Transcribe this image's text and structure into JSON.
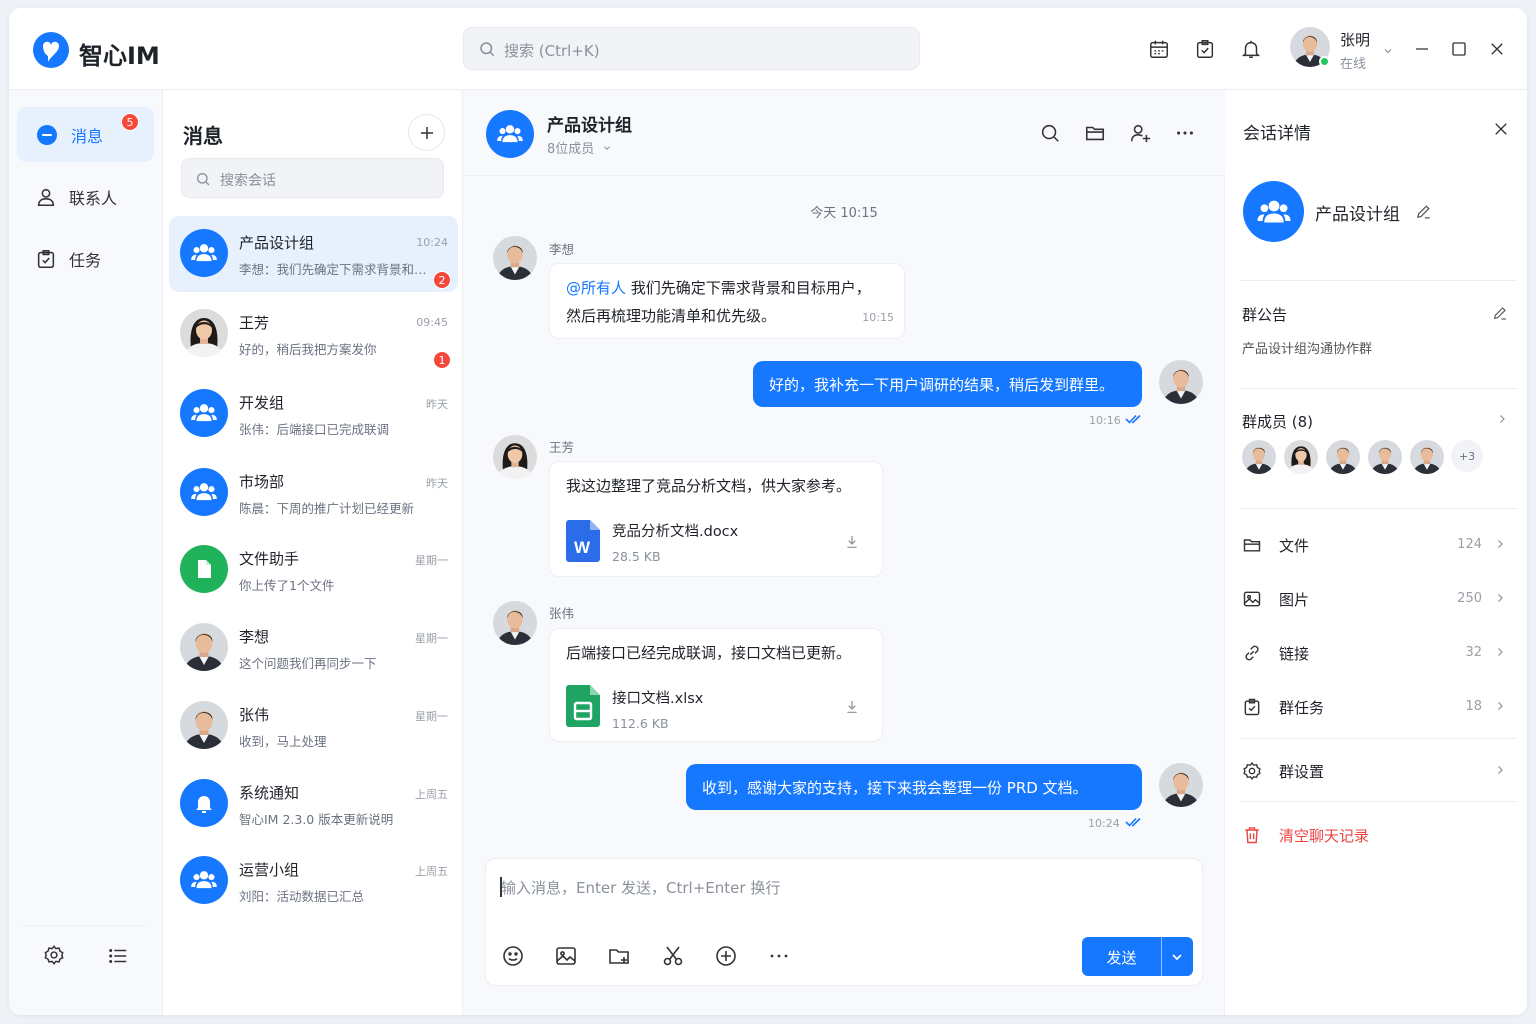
{
  "app": {
    "name": "智心IM",
    "search_placeholder": "搜索 (Ctrl+K)"
  },
  "user": {
    "name": "张明",
    "status": "在线"
  },
  "nav": {
    "items": [
      {
        "label": "消息",
        "badge": "5",
        "icon": "chat-icon",
        "active": true
      },
      {
        "label": "联系人",
        "icon": "contacts-icon"
      },
      {
        "label": "任务",
        "icon": "task-icon"
      }
    ]
  },
  "list": {
    "title": "消息",
    "search_placeholder": "搜索会话",
    "conversations": [
      {
        "name": "产品设计组",
        "preview": "李想：我们先确定下需求背景和目标用户...",
        "time": "10:24",
        "badge": "2",
        "avatar": "group-icon"
      },
      {
        "name": "王芳",
        "preview": "好的，稍后我把方案发你",
        "time": "09:45",
        "badge": "1",
        "avatar": "person-female"
      },
      {
        "name": "开发组",
        "preview": "张伟：后端接口已完成联调",
        "time": "昨天",
        "avatar": "group-icon"
      },
      {
        "name": "市场部",
        "preview": "陈晨：下周的推广计划已经更新",
        "time": "昨天",
        "avatar": "group-icon"
      },
      {
        "name": "文件助手",
        "preview": "你上传了1个文件",
        "time": "星期一",
        "avatar": "file-icon"
      },
      {
        "name": "李想",
        "preview": "这个问题我们再同步一下",
        "time": "星期一",
        "avatar": "person-male"
      },
      {
        "name": "张伟",
        "preview": "收到，马上处理",
        "time": "星期一",
        "avatar": "person-male"
      },
      {
        "name": "系统通知",
        "preview": "智心IM 2.3.0 版本更新说明",
        "time": "上周五",
        "avatar": "bell-icon"
      },
      {
        "name": "运营小组",
        "preview": "刘阳：活动数据已汇总",
        "time": "上周五",
        "avatar": "group-icon"
      }
    ]
  },
  "chat": {
    "title": "产品设计组",
    "subtitle": "8位成员",
    "date_label": "今天 10:15",
    "messages": [
      {
        "sender": "李想",
        "mention": "@所有人",
        "line1": " 我们先确定下需求背景和目标用户，",
        "line2": "然后再梳理功能清单和优先级。",
        "time": "10:15"
      },
      {
        "text": "好的，我补充一下用户调研的结果，稍后发到群里。",
        "time": "10:16"
      },
      {
        "sender": "王芳",
        "text": "我这边整理了竞品分析文档，供大家参考。",
        "file_name": "竞品分析文档.docx",
        "file_size": "28.5 KB",
        "file_icon": "W"
      },
      {
        "sender": "张伟",
        "text": "后端接口已经完成联调，接口文档已更新。",
        "file_name": "接口文档.xlsx",
        "file_size": "112.6 KB"
      },
      {
        "text": "收到，感谢大家的支持，接下来我会整理一份 PRD 文档。",
        "time": "10:24"
      }
    ],
    "input_placeholder": "输入消息，Enter 发送，Ctrl+Enter 换行",
    "send_label": "发送"
  },
  "details": {
    "title": "会话详情",
    "group_name": "产品设计组",
    "notice_title": "群公告",
    "notice_text": "产品设计组沟通协作群",
    "members_title": "群成员 (8)",
    "members_more": "+3",
    "rows": [
      {
        "label": "文件",
        "count": "124",
        "icon": "folder-icon"
      },
      {
        "label": "图片",
        "count": "250",
        "icon": "image-icon"
      },
      {
        "label": "链接",
        "count": "32",
        "icon": "link-icon"
      },
      {
        "label": "群任务",
        "count": "18",
        "icon": "task-icon"
      }
    ],
    "settings_label": "群设置",
    "clear_label": "清空聊天记录"
  },
  "colors": {
    "accent": "#1677ff",
    "danger": "#ef4444",
    "badge": "#f5483b",
    "online": "#22c55e",
    "word": "#2b6de8",
    "sheet": "#1fa463",
    "file_assistant": "#1fb25a"
  }
}
